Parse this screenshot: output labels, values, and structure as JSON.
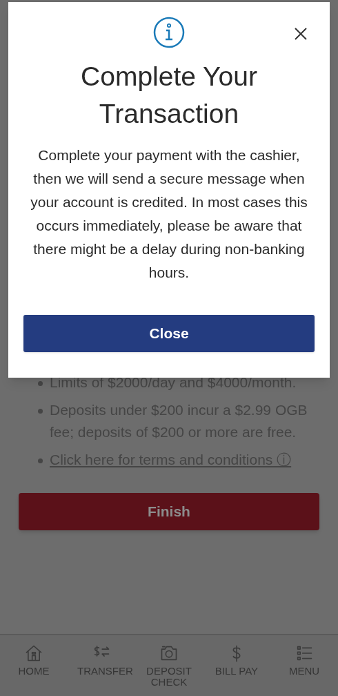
{
  "modal": {
    "title": "Complete Your Transaction",
    "message": "Complete your payment with the cashier, then we will send a secure message when your account is credited. In most cases this occurs immediately, please be aware that there might be a delay during non-banking hours.",
    "button": "Close"
  },
  "page": {
    "bullets": [
      {
        "kind": "text",
        "text": "Limits of $2000/day and $4000/month."
      },
      {
        "kind": "text",
        "text": "Deposits under $200 incur a $2.99 OGB fee; deposits of $200 or more are free."
      },
      {
        "kind": "link",
        "text": "Click here for terms and conditions ⓘ"
      }
    ],
    "button": "Finish"
  },
  "bottom_nav": [
    {
      "kind": "home",
      "label": "HOME"
    },
    {
      "kind": "transfer",
      "label": "TRANSFER"
    },
    {
      "kind": "camera",
      "label": "DEPOSIT CHECK"
    },
    {
      "kind": "dollar",
      "label": "BILL PAY"
    },
    {
      "kind": "menu",
      "label": "MENU"
    }
  ]
}
